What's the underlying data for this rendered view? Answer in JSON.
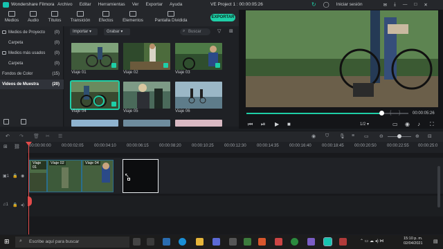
{
  "titlebar": {
    "app_name": "Wondershare Filmora",
    "menu": [
      "Archivo",
      "Editar",
      "Herramientas",
      "Ver",
      "Exportar",
      "Ayuda"
    ],
    "project_title": "VE Project 1 : 00:00:05:26",
    "signin": "Iniciar sesión"
  },
  "toolbar": {
    "tabs": [
      "Medios",
      "Audio",
      "Títulos",
      "Transición",
      "Efectos",
      "Elementos",
      "Pantalla Dividida"
    ],
    "export_label": "EXPORTAR"
  },
  "left_panel": {
    "items": [
      {
        "label": "Medios de Proyecto",
        "count": "(0)"
      },
      {
        "label": "Carpeta",
        "count": "(0)"
      },
      {
        "label": "Medios más usados",
        "count": "(0)"
      },
      {
        "label": "Carpeta",
        "count": "(0)"
      },
      {
        "label": "Fondos de Color",
        "count": "(15)"
      },
      {
        "label": "Videos de Muestra",
        "count": "(20)"
      }
    ]
  },
  "media": {
    "import_label": "Importar",
    "record_label": "Grabar",
    "search_placeholder": "Buscar",
    "thumbs": [
      "Viaje 01",
      "Viaje 02",
      "Viaje 03",
      "Viaje 04",
      "Viaje 05",
      "Viaje 06"
    ]
  },
  "preview": {
    "timecode": "00:00:05:26",
    "quality": "1/2"
  },
  "timeline": {
    "ticks": [
      "00:00:00:00",
      "00:00:02:05",
      "00:00:04:10",
      "00:00:06:15",
      "00:00:08:20",
      "00:00:10:25",
      "00:00:12:30",
      "00:00:14:35",
      "00:00:16:40",
      "00:00:18:45",
      "00:00:20:50",
      "00:00:22:55",
      "00:00:25:0"
    ],
    "clips": [
      "Viaje 01",
      "Viaje 02",
      "Viaje 04"
    ]
  },
  "taskbar": {
    "search_placeholder": "Escribe aquí para buscar",
    "time": "15:10 p. m.",
    "date": "02/04/2021"
  },
  "colors": {
    "accent": "#1ecfa7",
    "playhead": "#e24b4b"
  }
}
